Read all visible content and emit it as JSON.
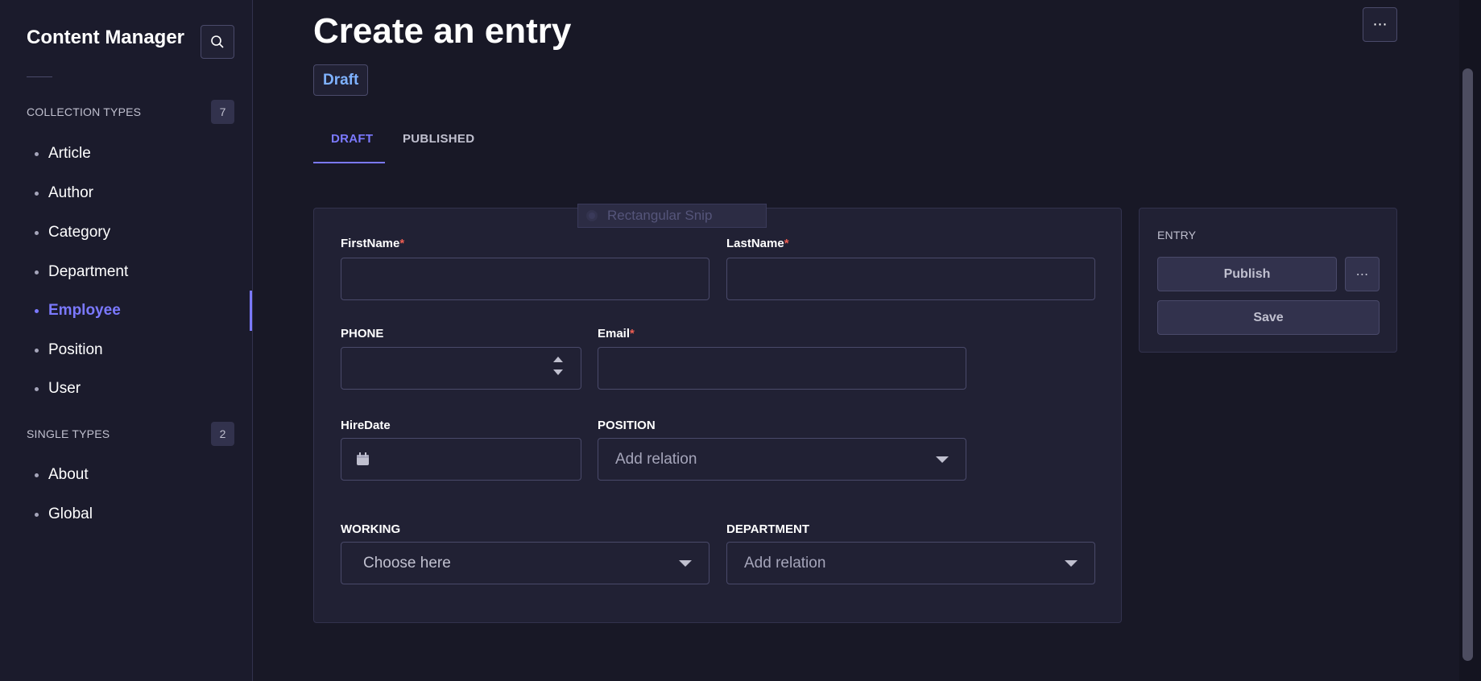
{
  "sidebar": {
    "title": "Content Manager",
    "collection_types": {
      "label": "COLLECTION TYPES",
      "count": "7",
      "items": [
        "Article",
        "Author",
        "Category",
        "Department",
        "Employee",
        "Position",
        "User"
      ]
    },
    "single_types": {
      "label": "SINGLE TYPES",
      "count": "2",
      "items": [
        "About",
        "Global"
      ]
    },
    "active_item": "Employee"
  },
  "main": {
    "title": "Create an entry",
    "status_badge": "Draft",
    "more_icon": "⋯",
    "tabs": [
      {
        "label": "DRAFT",
        "active": true
      },
      {
        "label": "PUBLISHED",
        "active": false
      }
    ]
  },
  "form": {
    "firstname": {
      "label": "FirstName",
      "required": "*",
      "value": ""
    },
    "lastname": {
      "label": "LastName",
      "required": "*",
      "value": ""
    },
    "phone": {
      "label": "PHONE",
      "value": ""
    },
    "email": {
      "label": "Email",
      "required": "*",
      "value": ""
    },
    "hiredate": {
      "label": "HireDate",
      "value": ""
    },
    "position": {
      "label": "POSITION",
      "placeholder": "Add relation"
    },
    "working": {
      "label": "WORKING",
      "value": "Choose here"
    },
    "department": {
      "label": "DEPARTMENT",
      "placeholder": "Add relation"
    }
  },
  "snip_overlay": {
    "label": "Rectangular Snip"
  },
  "entry_panel": {
    "title": "ENTRY",
    "publish_label": "Publish",
    "more_icon": "⋯",
    "save_label": "Save"
  },
  "colors": {
    "accent": "#7b79ff",
    "badge_text": "#7fb2ff",
    "required": "#ee5e52",
    "background": "#181826",
    "panel": "#212134"
  }
}
